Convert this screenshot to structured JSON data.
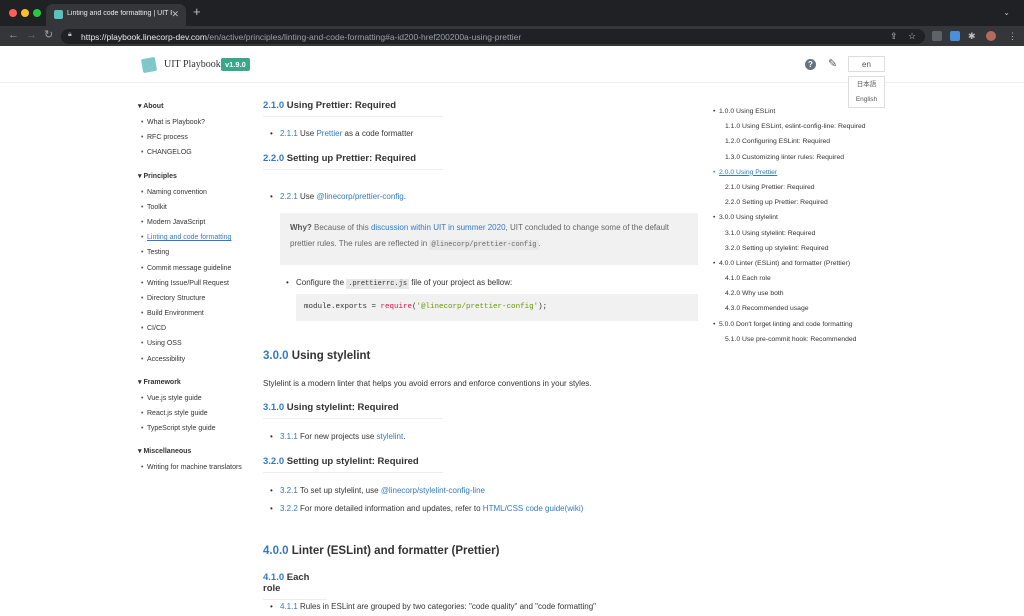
{
  "browser": {
    "tab_title": "Linting and code formatting | UIT Playbook",
    "url_domain": "https://playbook.linecorp-dev.com",
    "url_path": "/en/active/principles/linting-and-code-formatting#a-id200-href200200a-using-prettier"
  },
  "header": {
    "brand": "UIT Playbook",
    "version": "v1.9.0",
    "help": "?",
    "lang_current": "en",
    "lang_options": [
      "日本語",
      "English"
    ]
  },
  "sidebar": {
    "sections": [
      {
        "title": "▾ About",
        "items": [
          "What is Playbook?",
          "RFC process",
          "CHANGELOG"
        ]
      },
      {
        "title": "▾ Principles",
        "items": [
          "Naming convention",
          "Toolkit",
          "Modern JavaScript",
          "Linting and code formatting",
          "Testing",
          "Commit message guideline",
          "Writing Issue/Pull Request",
          "Directory Structure",
          "Build Environment",
          "CI/CD",
          "Using OSS",
          "Accessibility"
        ]
      },
      {
        "title": "▾ Framework",
        "items": [
          "Vue.js style guide",
          "React.js style guide",
          "TypeScript style guide"
        ]
      },
      {
        "title": "▾ Miscellaneous",
        "items": [
          "Writing for machine translators"
        ]
      }
    ]
  },
  "main": {
    "h210": {
      "num": "2.1.0",
      "text": " Using Prettier: Required"
    },
    "li211": {
      "num": "2.1.1",
      "pre": " Use ",
      "link": "Prettier",
      "post": " as a code formatter"
    },
    "h220": {
      "num": "2.2.0",
      "text": " Setting up Prettier: Required"
    },
    "li221": {
      "num": "2.2.1",
      "pre": " Use ",
      "link": "@linecorp/prettier-config",
      "post": "."
    },
    "note": {
      "why": "Why?",
      "t1": " Because of this ",
      "link": "discussion within UIT in summer 2020",
      "t2": ", UIT concluded to change some of the default prettier rules. The rules are reflected in ",
      "code": "@linecorp/prettier-config",
      "t3": "."
    },
    "configure": {
      "pre": "Configure the ",
      "code": ".prettierrc.js",
      "post": " file of your project as bellow:"
    },
    "codeblock": {
      "a": "module.exports = ",
      "b": "require",
      "c": "(",
      "d": "'@linecorp/prettier-config'",
      "e": ");"
    },
    "h300": {
      "num": "3.0.0",
      "text": " Using stylelint"
    },
    "p300": "Stylelint is a modern linter that helps you avoid errors and enforce conventions in your styles.",
    "h310": {
      "num": "3.1.0",
      "text": " Using stylelint: Required"
    },
    "li311": {
      "num": "3.1.1",
      "pre": " For new projects use ",
      "link": "stylelint",
      "post": "."
    },
    "h320": {
      "num": "3.2.0",
      "text": " Setting up stylelint: Required"
    },
    "li321": {
      "num": "3.2.1",
      "pre": " To set up stylelint, use ",
      "link": "@linecorp/stylelint-config-line"
    },
    "li322": {
      "num": "3.2.2",
      "pre": " For more detailed information and updates, refer to ",
      "link": "HTML/CSS code guide(wiki)"
    },
    "h400": {
      "num": "4.0.0",
      "text": " Linter (ESLint) and formatter (Prettier)"
    },
    "h410": {
      "num": "4.1.0",
      "text": " Each role"
    },
    "li411": {
      "num": "4.1.1",
      "pre": " Rules in ESLint are grouped by two categories: \"code quality\" and \"code formatting\""
    }
  },
  "toc": [
    {
      "level": 1,
      "text": "1.0.0 Using ESLint"
    },
    {
      "level": 2,
      "text": "1.1.0 Using ESLint, eslint-config-line: Required"
    },
    {
      "level": 2,
      "text": "1.2.0 Configuring ESLint: Required"
    },
    {
      "level": 2,
      "text": "1.3.0 Customizing linter rules: Required"
    },
    {
      "level": 1,
      "text": "2.0.0 Using Prettier",
      "active": true
    },
    {
      "level": 2,
      "text": "2.1.0 Using Prettier: Required"
    },
    {
      "level": 2,
      "text": "2.2.0 Setting up Prettier: Required"
    },
    {
      "level": 1,
      "text": "3.0.0 Using stylelint"
    },
    {
      "level": 2,
      "text": "3.1.0 Using stylelint: Required"
    },
    {
      "level": 2,
      "text": "3.2.0 Setting up stylelint: Required"
    },
    {
      "level": 1,
      "text": "4.0.0 Linter (ESLint) and formatter (Prettier)"
    },
    {
      "level": 2,
      "text": "4.1.0 Each role"
    },
    {
      "level": 2,
      "text": "4.2.0 Why use both"
    },
    {
      "level": 2,
      "text": "4.3.0 Recommended usage"
    },
    {
      "level": 1,
      "text": "5.0.0 Don't forget linting and code formatting"
    },
    {
      "level": 2,
      "text": "5.1.0 Use pre-commit hook: Recommended"
    }
  ],
  "colors": {
    "link": "#3279c5",
    "version_badge": "#3aa68a"
  }
}
